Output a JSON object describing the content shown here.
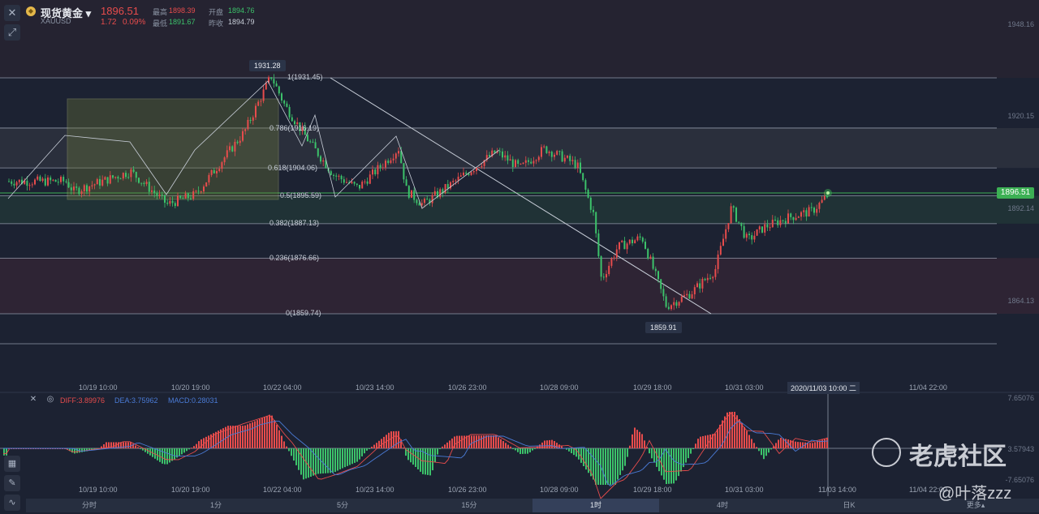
{
  "header": {
    "instrument_name": "现货黄金",
    "symbol": "XAUUSD",
    "price": "1896.51",
    "change": "1.72",
    "change_pct": "0.09%",
    "high_label": "最高",
    "high": "1898.39",
    "low_label": "最低",
    "low": "1891.67",
    "open_label": "开盘",
    "open": "1894.76",
    "prev_close_label": "昨收",
    "prev_close": "1894.79"
  },
  "chart": {
    "high_marker": "1931.28",
    "low_marker": "1859.91",
    "current_price_tag": "1896.51",
    "y_ticks": [
      "1948.16",
      "1920.15",
      "1892.14",
      "1864.13"
    ],
    "fib_levels": [
      {
        "ratio": "1",
        "label": "1(1931.45)",
        "price": 1931.45
      },
      {
        "ratio": "0.786",
        "label": "0.786(1916.19)",
        "price": 1916.19
      },
      {
        "ratio": "0.618",
        "label": "0.618(1904.06)",
        "price": 1904.06
      },
      {
        "ratio": "0.5",
        "label": "0.5(1895.59)",
        "price": 1895.59
      },
      {
        "ratio": "0.382",
        "label": "0.382(1887.13)",
        "price": 1887.13
      },
      {
        "ratio": "0.236",
        "label": "0.236(1876.66)",
        "price": 1876.66
      },
      {
        "ratio": "0",
        "label": "0(1859.74)",
        "price": 1859.74
      }
    ],
    "x_ticks": [
      "10/19 10:00",
      "10/20 19:00",
      "10/22 04:00",
      "10/23 14:00",
      "10/26 23:00",
      "10/28 09:00",
      "10/29 18:00",
      "10/31 03:00",
      "2020/11/03 10:00 二",
      "11/04 22:00"
    ],
    "colors": {
      "up": "#e74c4c",
      "down": "#3cc26a",
      "fib_line": "#8f98a8",
      "current": "#3cb054"
    }
  },
  "indicator": {
    "diff": "DIFF:3.89976",
    "dea": "DEA:3.75962",
    "macd": "MACD:0.28031",
    "y_ticks": [
      "7.65076",
      "3.57943",
      "-7.65076"
    ],
    "x_ticks": [
      "10/19 10:00",
      "10/20 19:00",
      "10/22 04:00",
      "10/23 14:00",
      "10/26 23:00",
      "10/28 09:00",
      "10/29 18:00",
      "10/31 03:00",
      "11/03 14:00",
      "11/04 22:00"
    ],
    "colors": {
      "diff": "#e74c4c",
      "dea": "#4a7bd6"
    }
  },
  "periods": [
    {
      "label": "分时",
      "active": false
    },
    {
      "label": "1分",
      "active": false
    },
    {
      "label": "5分",
      "active": false
    },
    {
      "label": "15分",
      "active": false
    },
    {
      "label": "1时",
      "active": true
    },
    {
      "label": "4时",
      "active": false
    },
    {
      "label": "日K",
      "active": false
    },
    {
      "label": "更多▴",
      "active": false
    }
  ],
  "watermark": {
    "brand": "老虎社区",
    "user": "@叶落zzz"
  }
}
